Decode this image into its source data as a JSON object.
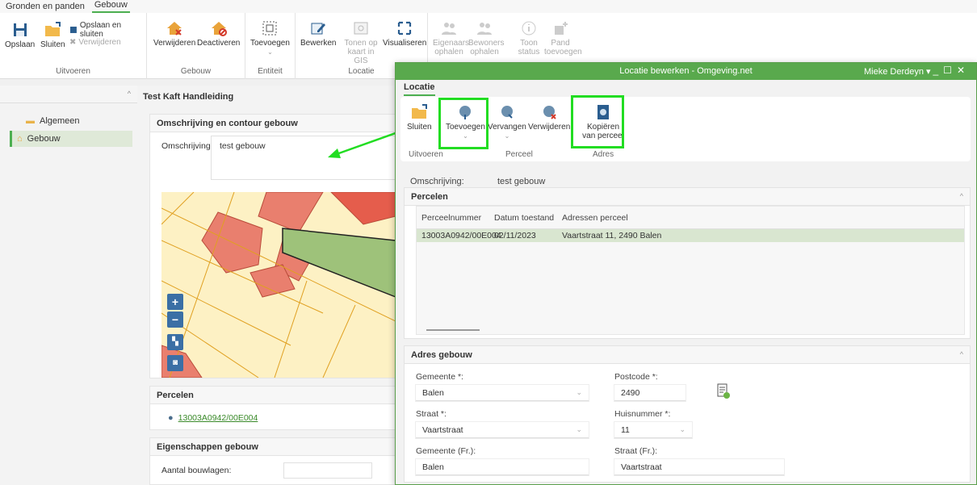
{
  "menubar": {
    "items": [
      "Gronden en panden",
      "Gebouw"
    ]
  },
  "ribbon": {
    "uitvoeren": {
      "opslaan": "Opslaan",
      "sluiten": "Sluiten",
      "opslaan_sluiten": "Opslaan en sluiten",
      "verwijderen": "Verwijderen",
      "group": "Uitvoeren"
    },
    "gebouw": {
      "verwijderen": "Verwijderen",
      "deactiveren": "Deactiveren",
      "group": "Gebouw"
    },
    "entiteit": {
      "toevoegen": "Toevoegen",
      "group": "Entiteit"
    },
    "locatie": {
      "bewerken": "Bewerken",
      "tonen": "Tonen op kaart in GIS",
      "visualiseren": "Visualiseren",
      "group": "Locatie"
    },
    "extra": {
      "eigenaars": "Eigenaars ophalen",
      "bewoners": "Bewoners ophalen",
      "toon": "Toon status",
      "pand": "Pand toevoegen"
    }
  },
  "leftpanel": {
    "items": [
      "Algemeen",
      "Gebouw"
    ]
  },
  "main": {
    "title": "Test Kaft Handleiding",
    "omschrijving_section": "Omschrijving en contour gebouw",
    "omschrijving_label": "Omschrijving:",
    "omschrijving_value": "test gebouw",
    "percelen_section": "Percelen",
    "perceel_link": "13003A0942/00E004",
    "eigenschappen_section": "Eigenschappen gebouw",
    "bouwlagen_label": "Aantal bouwlagen:"
  },
  "modal": {
    "title": "Locatie bewerken - Omgeving.net",
    "user": "Mieke Derdeyn",
    "tab": "Locatie",
    "buttons": {
      "sluiten": "Sluiten",
      "toevoegen": "Toevoegen",
      "vervangen": "Vervangen",
      "verwijderen": "Verwijderen",
      "kopieren": "Kopiëren van perceel"
    },
    "groups": {
      "uitvoeren": "Uitvoeren",
      "perceel": "Perceel",
      "adres": "Adres"
    },
    "omschrijving_label": "Omschrijving:",
    "omschrijving_value": "test gebouw",
    "percelen": {
      "title": "Percelen",
      "headers": [
        "Perceelnummer",
        "Datum toestand",
        "Adressen perceel"
      ],
      "rows": [
        [
          "13003A0942/00E004",
          "02/11/2023",
          "Vaartstraat 11, 2490 Balen"
        ]
      ]
    },
    "adres": {
      "title": "Adres gebouw",
      "gemeente_label": "Gemeente *:",
      "gemeente_value": "Balen",
      "postcode_label": "Postcode *:",
      "postcode_value": "2490",
      "straat_label": "Straat *:",
      "straat_value": "Vaartstraat",
      "huisnummer_label": "Huisnummer *:",
      "huisnummer_value": "11",
      "gemeente_fr_label": "Gemeente (Fr.):",
      "gemeente_fr_value": "Balen",
      "straat_fr_label": "Straat (Fr.):",
      "straat_fr_value": "Vaartstraat"
    }
  },
  "colors": {
    "accent": "#59a94d",
    "highlight": "#22dd22",
    "selected_row": "#d9e6d0"
  }
}
